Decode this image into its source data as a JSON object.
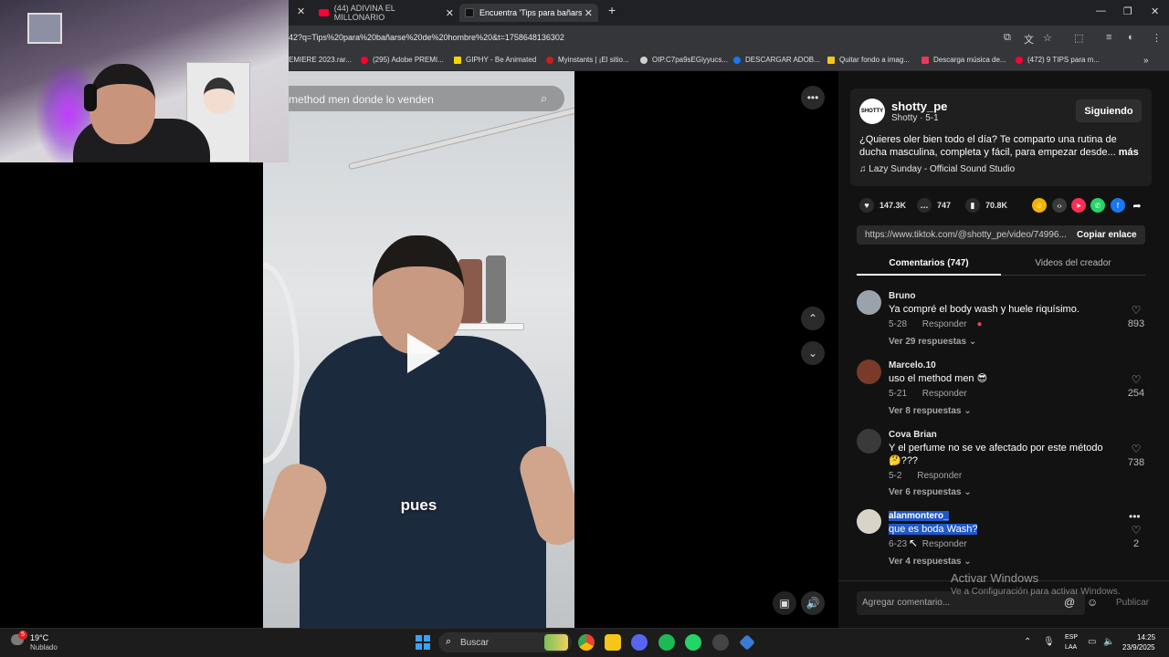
{
  "browser": {
    "tabs": [
      {
        "label": "(44) ADIVINA EL MILLONARIO"
      },
      {
        "label": "Encuentra 'Tips para bañarse d"
      }
    ],
    "url": "42?q=Tips%20para%20bañarse%20de%20hombre%20&t=1758648136302",
    "bookmarks": [
      {
        "label": "EMIERE 2023.rar..."
      },
      {
        "label": "(295) Adobe PREMI..."
      },
      {
        "label": "GIPHY - Be Animated"
      },
      {
        "label": "Myinstants | ¡El sitio..."
      },
      {
        "label": "OIP.C7pa9sEGiyyucs..."
      },
      {
        "label": "DESCARGAR ADOB..."
      },
      {
        "label": "Quitar fondo a imag..."
      },
      {
        "label": "Descarga música de..."
      },
      {
        "label": "(472) 9 TIPS para m..."
      }
    ]
  },
  "video": {
    "search_text": "method men donde lo venden",
    "caption": "pues"
  },
  "creator": {
    "avatar_text": "SHOTTY",
    "username": "shotty_pe",
    "subtitle": "Shotty · 5-1",
    "follow_label": "Siguiendo",
    "description": "¿Quieres oler bien todo el día? Te comparto una rutina de ducha masculina, completa y fácil, para empezar desde...",
    "more_label": "más",
    "music": "Lazy Sunday - Official Sound Studio"
  },
  "stats": {
    "likes": "147.3K",
    "comments": "747",
    "saves": "70.8K"
  },
  "link": {
    "url": "https://www.tiktok.com/@shotty_pe/video/74996...",
    "copy_label": "Copiar enlace"
  },
  "tabs": {
    "comments": "Comentarios (747)",
    "creator_videos": "Videos del creador"
  },
  "comments": [
    {
      "user": "Bruno",
      "text": "Ya compré el body wash y huele riquísimo.",
      "date": "5-28",
      "reply": "Responder",
      "replies": "Ver 29 respuestas",
      "likes": "893"
    },
    {
      "user": "Marcelo.10",
      "text": "uso el method men 😎",
      "date": "5-21",
      "reply": "Responder",
      "replies": "Ver 8 respuestas",
      "likes": "254"
    },
    {
      "user": "Cova Brian",
      "text": "Y el perfume no se ve afectado por este método 🤔???",
      "date": "5-2",
      "reply": "Responder",
      "replies": "Ver 6 respuestas",
      "likes": "738"
    },
    {
      "user": "alanmontero_",
      "text": "que es boda Wash?",
      "date": "6-23",
      "reply": "Responder",
      "replies": "Ver 4 respuestas",
      "likes": "2"
    }
  ],
  "comment_input": {
    "placeholder": "Agregar comentario...",
    "publish_label": "Publicar"
  },
  "watermark": {
    "title": "Activar Windows",
    "subtitle": "Ve a Configuración para activar Windows."
  },
  "taskbar": {
    "temperature": "19°C",
    "weather": "Nublado",
    "search_label": "Buscar",
    "lang1": "ESP",
    "lang2": "LAA",
    "time": "14:25",
    "date": "23/9/2025"
  },
  "colors": {
    "accent_blue": "#2058c8",
    "youtube_red": "#ff0033",
    "panel_bg": "#121212"
  }
}
